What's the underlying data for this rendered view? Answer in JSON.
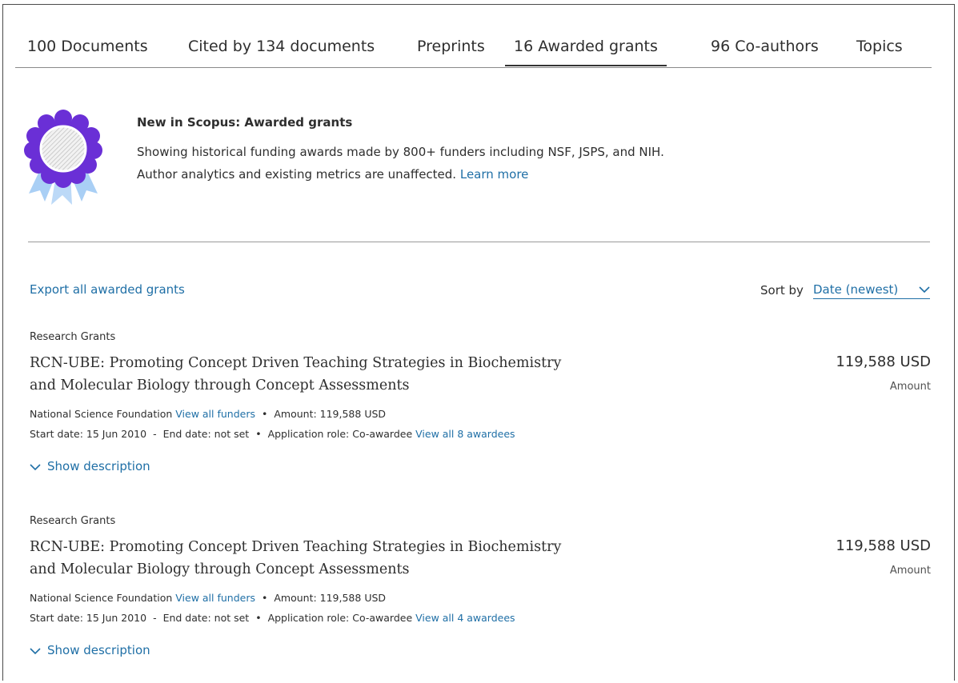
{
  "tabs": [
    {
      "label": "100 Documents",
      "active": false
    },
    {
      "label": "Cited by 134 documents",
      "active": false
    },
    {
      "label": "Preprints",
      "active": false
    },
    {
      "label": "16 Awarded grants",
      "active": true
    },
    {
      "label": "96 Co-authors",
      "active": false
    },
    {
      "label": "Topics",
      "active": false
    }
  ],
  "banner": {
    "icon": "award-ribbon-icon",
    "title": "New in Scopus: Awarded grants",
    "text": "Showing historical funding awards made by 800+ funders including NSF, JSPS, and NIH. Author analytics and existing metrics are unaffected.",
    "link": "Learn more"
  },
  "controls": {
    "export_label": "Export all awarded grants",
    "sort_label": "Sort by",
    "sort_value": "Date (newest)"
  },
  "grants": [
    {
      "category": "Research Grants",
      "title": "RCN-UBE: Promoting Concept Driven Teaching Strategies in Biochemistry and Molecular Biology through Concept Assessments",
      "amount": "119,588 USD",
      "amount_label": "Amount",
      "funder": "National Science Foundation",
      "funders_link": "View all funders",
      "amount_text": "Amount: 119,588 USD",
      "start": "Start date: 15 Jun 2010",
      "end": "End date: not set",
      "role": "Application role: Co-awardee",
      "awardees_link": "View all 8 awardees",
      "show_label": "Show description"
    },
    {
      "category": "Research Grants",
      "title": "RCN-UBE: Promoting Concept Driven Teaching Strategies in Biochemistry and Molecular Biology through Concept Assessments",
      "amount": "119,588 USD",
      "amount_label": "Amount",
      "funder": "National Science Foundation",
      "funders_link": "View all funders",
      "amount_text": "Amount: 119,588 USD",
      "start": "Start date: 15 Jun 2010",
      "end": "End date: not set",
      "role": "Application role: Co-awardee",
      "awardees_link": "View all 4 awardees",
      "show_label": "Show description"
    }
  ],
  "colors": {
    "link": "#1f6fa6",
    "badge_purple": "#6a2fd6",
    "badge_ribbon": "#9fc8f0"
  }
}
